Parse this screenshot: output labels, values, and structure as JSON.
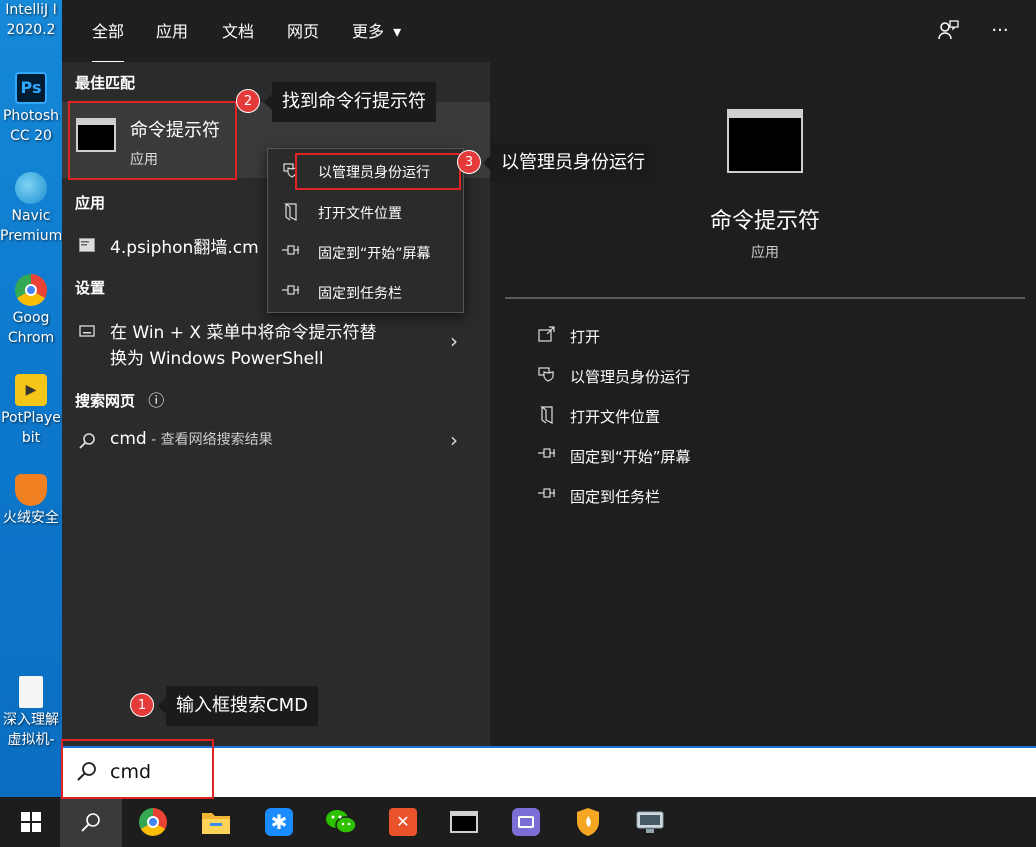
{
  "desktop": {
    "icons": [
      {
        "name": "intellij",
        "label1": "IntelliJ I",
        "label2": "2020.2",
        "color": "#000000"
      },
      {
        "name": "photoshop",
        "label1": "Photosh",
        "label2": "CC 20",
        "glyph": "Ps",
        "color": "#001d34"
      },
      {
        "name": "navicat",
        "label1": "Navic",
        "label2": "Premium",
        "color": "#2aa4d5"
      },
      {
        "name": "chrome",
        "label1": "Goog",
        "label2": "Chrom",
        "color": "#34a853"
      },
      {
        "name": "potplayer",
        "label1": "PotPlaye",
        "label2": "bit",
        "color": "#f5c518"
      },
      {
        "name": "huorong",
        "label1": "火绒安全",
        "label2": "",
        "color": "#f08020"
      },
      {
        "name": "document",
        "label1": "深入理解",
        "label2": "虚拟机-",
        "color": "#f5f5f5"
      }
    ]
  },
  "nav": {
    "tabs": [
      "全部",
      "应用",
      "文档",
      "网页",
      "更多"
    ],
    "more_arrow": "▾",
    "feedback_icon": "feedback-icon",
    "more_options": "···"
  },
  "left": {
    "best_match_title": "最佳匹配",
    "best_match": {
      "name": "命令提示符",
      "type": "应用"
    },
    "apps_title": "应用",
    "app_item": "4.psiphon翻墙.cm",
    "settings_title": "设置",
    "settings_line1": "在 Win + X 菜单中将命令提示符替",
    "settings_line2": "换为 Windows PowerShell",
    "web_title": "搜索网页",
    "web_query": "cmd",
    "web_suffix": " - 查看网络搜索结果",
    "info_icon": "ⓘ",
    "chevron": "›"
  },
  "context_menu": {
    "items": [
      {
        "icon": "shield-icon",
        "label": "以管理员身份运行"
      },
      {
        "icon": "folder-icon",
        "label": "打开文件位置"
      },
      {
        "icon": "pin-icon",
        "label": "固定到“开始”屏幕"
      },
      {
        "icon": "pin-icon",
        "label": "固定到任务栏"
      }
    ]
  },
  "right": {
    "app_name": "命令提示符",
    "app_type": "应用",
    "actions": [
      {
        "icon": "open-icon",
        "label": "打开"
      },
      {
        "icon": "shield-icon",
        "label": "以管理员身份运行"
      },
      {
        "icon": "folder-icon",
        "label": "打开文件位置"
      },
      {
        "icon": "pin-icon",
        "label": "固定到“开始”屏幕"
      },
      {
        "icon": "pin-icon",
        "label": "固定到任务栏"
      }
    ]
  },
  "search": {
    "value": "cmd"
  },
  "taskbar": {
    "apps": [
      "start-icon",
      "search-icon",
      "chrome-icon",
      "explorer-icon",
      "dingtalk-icon",
      "wechat-icon",
      "xmind-icon",
      "terminal-icon",
      "server-icon",
      "huorong-icon",
      "monitor-icon"
    ]
  },
  "annotations": {
    "a1": {
      "num": "1",
      "text": "输入框搜索CMD"
    },
    "a2": {
      "num": "2",
      "text": "找到命令行提示符"
    },
    "a3": {
      "num": "3",
      "text": "以管理员身份运行"
    }
  },
  "colors": {
    "accent": "#e43a3a",
    "menu_bg": "#1f1f1f",
    "pane_bg": "#2b2b2b"
  }
}
